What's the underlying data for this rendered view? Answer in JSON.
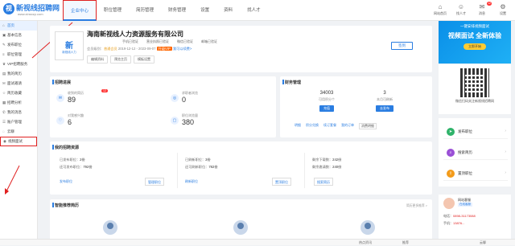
{
  "brand": {
    "name": "新视线招聘网",
    "url": "www.xinsxzp.com",
    "mark": "视",
    "accent": "#2a7de1",
    "highlight": "#e02020"
  },
  "nav": [
    "企业中心",
    "职位管理",
    "简历管理",
    "财务管理",
    "设置",
    "资料",
    "找人才"
  ],
  "header_icons": [
    {
      "label": "网站首页",
      "icon": "home-icon",
      "glyph": "⌂"
    },
    {
      "label": "找人才",
      "icon": "user-search-icon",
      "glyph": "☺"
    },
    {
      "label": "消息",
      "icon": "bell-icon",
      "glyph": "✉",
      "badge": "12"
    },
    {
      "label": "设置",
      "icon": "gear-icon",
      "glyph": "⚙"
    }
  ],
  "sidebar": [
    {
      "label": "首页",
      "icon": "home-icon",
      "glyph": "⌂"
    },
    {
      "label": "基本信息",
      "icon": "info-icon",
      "glyph": "▣"
    },
    {
      "label": "发布职位",
      "icon": "publish-icon",
      "glyph": "✎"
    },
    {
      "label": "职位管理",
      "icon": "list-icon",
      "glyph": "≡"
    },
    {
      "label": "VIP招聘服务",
      "icon": "vip-icon",
      "glyph": "♛"
    },
    {
      "label": "我的简历",
      "icon": "resume-icon",
      "glyph": "▤"
    },
    {
      "label": "面试邀请",
      "icon": "invite-icon",
      "glyph": "✉"
    },
    {
      "label": "简历收藏",
      "icon": "star-icon",
      "glyph": "☆"
    },
    {
      "label": "招聘分析",
      "icon": "chart-icon",
      "glyph": "▦"
    },
    {
      "label": "我的消息",
      "icon": "message-icon",
      "glyph": "✆"
    },
    {
      "label": "账户管理",
      "icon": "account-icon",
      "glyph": "☰"
    },
    {
      "label": "云聊",
      "icon": "chat-icon",
      "glyph": "◌"
    },
    {
      "label": "视频面试",
      "icon": "video-icon",
      "glyph": "◉"
    }
  ],
  "company": {
    "logo_main": "新",
    "logo_text": "新视线人力",
    "name": "海南新视线人力资源服务有限公司",
    "verify": [
      "手机已验证",
      "营业执照已验证",
      "微信已验证",
      "邮箱已验证"
    ],
    "member_label": "会员级别：",
    "member_level": "普通会员",
    "member_date": "2019-12-12 - 2023-09-07",
    "vip": "升级VIP",
    "renew": "我可以续费>",
    "buttons": [
      "编辑资料",
      "预览主页",
      "模板设置"
    ],
    "sign": "签到"
  },
  "recruit": {
    "title": "招聘进展",
    "stats": [
      {
        "label": "收到的简历",
        "value": "89",
        "badge": "12",
        "icon": "inbox-icon",
        "glyph": "✉"
      },
      {
        "label": "求职者浏览",
        "value": "0",
        "icon": "eye-icon",
        "glyph": "◎"
      },
      {
        "label": "对我感兴趣",
        "value": "6",
        "icon": "heart-icon",
        "glyph": "♡"
      },
      {
        "label": "职位浏览量",
        "value": "380",
        "icon": "view-icon",
        "glyph": "▢"
      }
    ]
  },
  "finance": {
    "title": "财务管理",
    "cols": [
      {
        "value": "34003",
        "label": "可用积分个",
        "button": "充值"
      },
      {
        "value": "3",
        "label": "本月可刷新",
        "button": "去发布"
      }
    ],
    "links": [
      "明细",
      "积分兑换",
      "续订套餐",
      "我的订单",
      "消费明细"
    ]
  },
  "resources": {
    "title": "我的招聘资源",
    "cols": [
      {
        "lines": [
          [
            "已发布职位：",
            "2份"
          ],
          [
            "还可发布职位：",
            "792份"
          ]
        ],
        "btn1": "发布职位",
        "btn2": "管理职位"
      },
      {
        "lines": [
          [
            "已刷新职位：",
            "3份"
          ],
          [
            "还可刷新职位：",
            "782份"
          ]
        ],
        "btn1": "刷新职位",
        "btn2": "置顶职位"
      },
      {
        "lines": [
          [
            "剩余下载数：",
            "242份"
          ],
          [
            "剩余邀请数：",
            "240份"
          ]
        ],
        "btn1": "",
        "btn2": "搜索简历"
      }
    ]
  },
  "smart": {
    "title": "智能推荐简历",
    "more": "简历更多推荐 >"
  },
  "right_panel": {
    "banner_top": "一键安排视频面试",
    "banner_main": "视频面试 全新体验",
    "banner_btn": "立即开始",
    "qr_text": "微信扫码关注新视线招聘网",
    "menu": [
      {
        "label": "发布职位",
        "icon": "send-icon",
        "glyph": "➤",
        "color": "#2fb36a"
      },
      {
        "label": "搜索简历",
        "icon": "search-icon",
        "glyph": "⌕",
        "color": "#9a4fd6"
      },
      {
        "label": "置顶职位",
        "icon": "top-icon",
        "glyph": "⇧",
        "color": "#f39b1a"
      }
    ],
    "contact": {
      "name": "网站客服",
      "badge": "在线客服",
      "phone_label": "电话：",
      "phone": "0898-31173088",
      "mobile_label": "手机：",
      "mobile": "13876..."
    }
  },
  "bottom": [
    "热点资讯",
    "推荐",
    "云聊"
  ]
}
